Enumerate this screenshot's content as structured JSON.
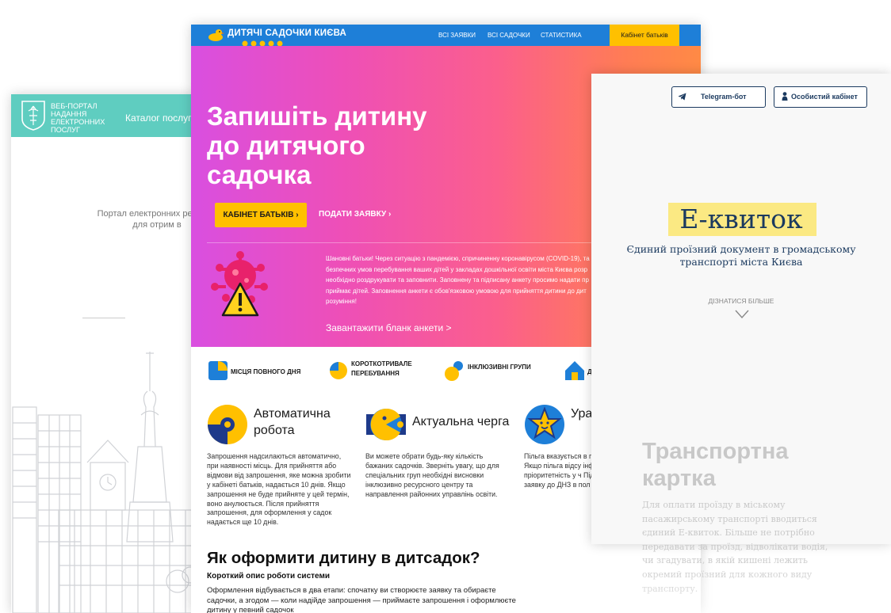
{
  "portal": {
    "logo_text": "ВЕБ-ПОРТАЛ НАДАННЯ ЕЛЕКТРОННИХ ПОСЛУГ",
    "nav_catalog": "Каталог послуг",
    "description": "Портал електронних ресурсів для отрим в"
  },
  "kindergarten": {
    "brand": "ДИТЯЧІ САДОЧКИ КИЄВА",
    "nav": {
      "all_requests": "ВСІ ЗАЯВКИ",
      "all_kindergartens": "ВСІ САДОЧКИ",
      "statistics": "СТАТИСТИКА",
      "cabinet": "Кабінет батьків"
    },
    "hero": {
      "title": "Запишіть дитину до дитячого садочка",
      "btn_cabinet": "КАБІНЕТ БАТЬКІВ ›",
      "btn_apply": "ПОДАТИ ЗАЯВКУ ›",
      "notice": "Шановні батьки! Через ситуацію з пандемією, спричиненну коронавірусом (COVID-19), та безпечних умов перебування ваших дітей у закладах дошкільної освіти міста Києва розр необхідно роздрукувати та заповнити. Заповнену та підписану анкету просимо надати пр приймає дітей. Заповнення анкети є обов'язковою умовою для прийняття дитини до дит розуміння!",
      "download": "Завантажити бланк анкети >"
    },
    "features": [
      {
        "label": "МІСЦЯ ПОВНОГО ДНЯ"
      },
      {
        "label": "КОРОТКОТРИВАЛЕ ПЕРЕБУВАННЯ"
      },
      {
        "label": "ІНКЛЮЗИВНІ ГРУПИ"
      },
      {
        "label": "Д"
      }
    ],
    "columns": [
      {
        "title": "Автоматична робота",
        "text": "Запрошення надсилаються автоматично, при наявності місць. Для прийняття або відмови від запрошення, яке можна зробити у кабінеті батьків, надається 10 днів. Якщо запрошення не буде прийняте у цей термін, воно анулюється. Після прийняття запрошення, для оформлення у садок надається ще 10 днів."
      },
      {
        "title": "Актуальна черга",
        "text": "Ви можете обрати будь-яку кількість бажаних садочків. Зверніть увагу, що для спеціальних груп необхідні висновки інклюзивно ресурсного центру та направлення районних управлінь освіти."
      },
      {
        "title": "Ура пільг",
        "text": "Пільга вказується в підтверджується при Якщо пільга відсу інформація про неї н пріоритетність у ч Підтверджені пільги заявку до ДНЗ в пол"
      }
    ],
    "how": {
      "title": "Як оформити дитину в дитсадок?",
      "subtitle": "Короткий опис роботи системи",
      "text": "Оформлення відбувається в два етапи: спочатку ви створюєте заявку та обираєте садочки, а згодом — коли надійде запрошення — приймаєте запрошення і оформлюєте дитину у певний садочок"
    }
  },
  "eticket": {
    "telegram": "Telegram-бот",
    "cabinet": "Особистий кабінет",
    "title": "Е-квиток",
    "subtitle": "Єдиний проїзний документ в громадському транспорті міста Києва",
    "more": "ДІЗНАТИСЯ БІЛЬШЕ",
    "transport_title": "Транспортна картка",
    "transport_text": "Для оплати проїзду в міському пасажирському транспорті вводиться єдиний Е-квиток. Більше не потрібно передавати за проїзд, відволікати водія, чи згадувати, в якій кишені лежить окремий проїзний для кожного виду транспорту.",
    "colors": {
      "navy": "#1b3a5f",
      "highlight": "#fbe983"
    }
  },
  "colors": {
    "teal": "#5fcdc0",
    "blue": "#1e7fd8",
    "yellow": "#ffc000",
    "pink": "#ee4fb7"
  }
}
